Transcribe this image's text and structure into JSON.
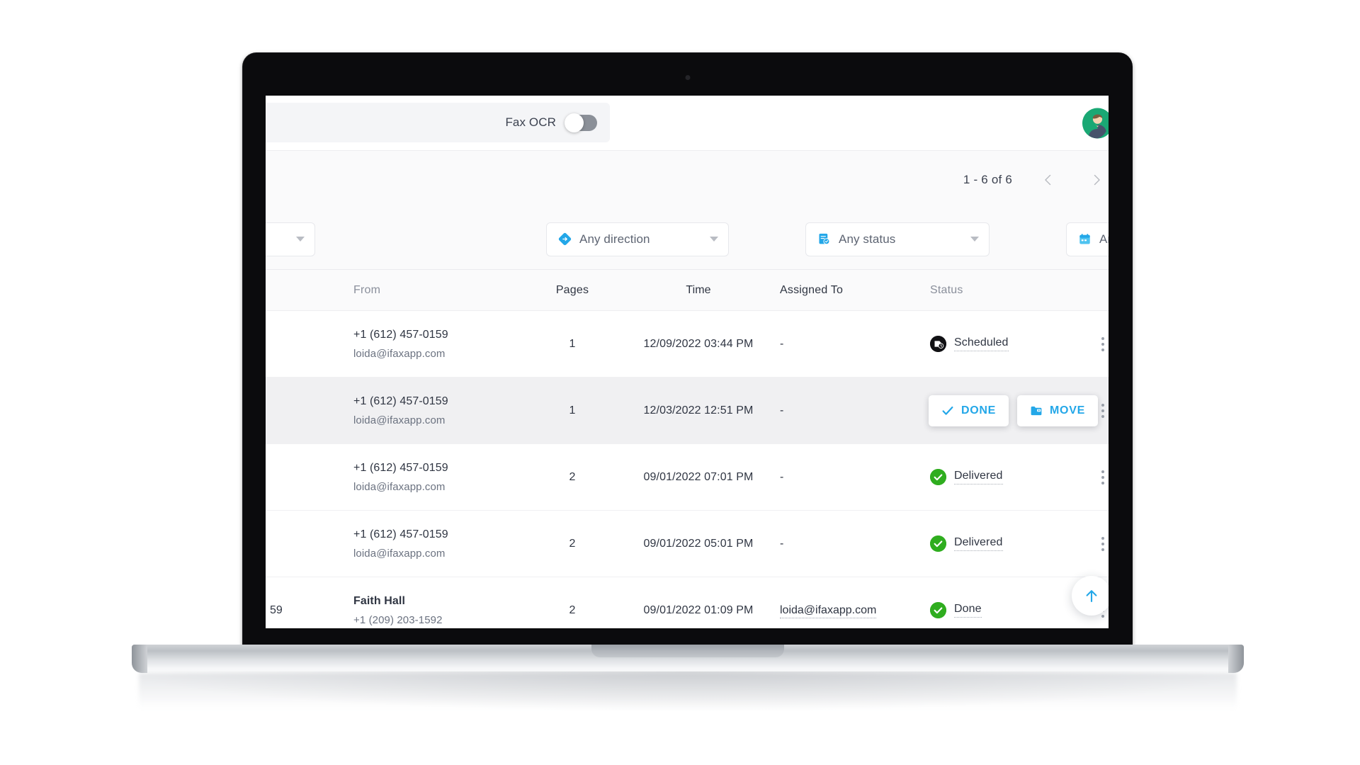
{
  "topbar": {
    "ocr_label": "Fax OCR",
    "ocr_toggle_state": "off",
    "avatar_name": "user-avatar"
  },
  "pager": {
    "range_text": "1 - 6 of 6",
    "prev_label": "Previous page",
    "next_label": "Next page"
  },
  "filters": [
    {
      "name": "folder",
      "label": "",
      "icon": "none"
    },
    {
      "name": "direction",
      "label": "Any direction",
      "icon": "direction-diamond-icon"
    },
    {
      "name": "status",
      "label": "Any status",
      "icon": "status-document-icon"
    },
    {
      "name": "time",
      "label": "Any time",
      "icon": "calendar-icon"
    }
  ],
  "table": {
    "headers": {
      "from": "From",
      "pages": "Pages",
      "time": "Time",
      "assigned": "Assigned To",
      "status": "Status"
    },
    "rows": [
      {
        "name": "",
        "from_primary": "+1 (612) 457-0159",
        "from_secondary": "loida@ifaxapp.com",
        "from_bold": false,
        "pages": "1",
        "time": "12/09/2022 03:44 PM",
        "assigned": "-",
        "status_label": "Scheduled",
        "status_color": "black",
        "hovered": false
      },
      {
        "name": "",
        "from_primary": "+1 (612) 457-0159",
        "from_secondary": "loida@ifaxapp.com",
        "from_bold": false,
        "pages": "1",
        "time": "12/03/2022 12:51 PM",
        "assigned": "-",
        "status_label": "",
        "status_color": "green",
        "hovered": true
      },
      {
        "name": "",
        "from_primary": "+1 (612) 457-0159",
        "from_secondary": "loida@ifaxapp.com",
        "from_bold": false,
        "pages": "2",
        "time": "09/01/2022 07:01 PM",
        "assigned": "-",
        "status_label": "Delivered",
        "status_color": "green",
        "hovered": false
      },
      {
        "name": "",
        "from_primary": "+1 (612) 457-0159",
        "from_secondary": "loida@ifaxapp.com",
        "from_bold": false,
        "pages": "2",
        "time": "09/01/2022 05:01 PM",
        "assigned": "-",
        "status_label": "Delivered",
        "status_color": "green",
        "hovered": false
      },
      {
        "name": "59",
        "from_primary": "Faith Hall",
        "from_secondary": "+1 (209) 203-1592",
        "from_bold": true,
        "pages": "2",
        "time": "09/01/2022 01:09 PM",
        "assigned": "loida@ifaxapp.com",
        "status_label": "Done",
        "status_color": "green",
        "hovered": false
      }
    ]
  },
  "row_actions": {
    "done_label": "DONE",
    "move_label": "MOVE"
  },
  "fab": {
    "name": "scroll-to-top-button"
  },
  "colors": {
    "accent_blue": "#23a7e8",
    "status_green": "#2fad1f",
    "status_black": "#111114",
    "avatar_green": "#1aa874",
    "row_hover": "#f0f0f2"
  }
}
